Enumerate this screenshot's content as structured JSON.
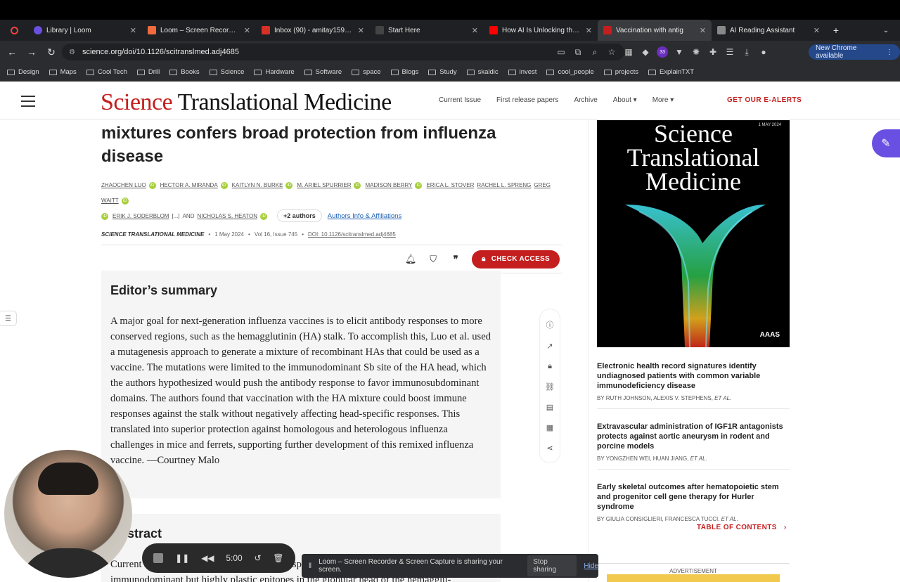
{
  "browser": {
    "tabs": [
      {
        "title": "Library | Loom",
        "color": "#6a4fe3",
        "active": false
      },
      {
        "title": "Loom – Screen Recorder & S",
        "color": "#ef6a3c",
        "active": false
      },
      {
        "title": "Inbox (90) - amitay1599@",
        "color": "#d93025",
        "active": false
      },
      {
        "title": "Start Here",
        "color": "#444444",
        "active": false
      },
      {
        "title": "How AI Is Unlocking the S",
        "color": "#ff0000",
        "active": false
      },
      {
        "title": "Vaccination with antig",
        "color": "#c41e1e",
        "active": true
      },
      {
        "title": "AI Reading Assistant",
        "color": "#888888",
        "active": false
      }
    ],
    "url": "science.org/doi/10.1126/scitranslmed.adj4685",
    "ext_badge": "33",
    "new_chrome": "New Chrome available",
    "bookmarks": [
      "Design",
      "Maps",
      "Cool Tech",
      "Drill",
      "Books",
      "Science",
      "Hardware",
      "Software",
      "space",
      "Blogs",
      "Study",
      "skaldic",
      "invest",
      "cool_people",
      "projects",
      "ExplainTXT"
    ]
  },
  "site": {
    "logo_a": "Science",
    "logo_b": "Translational Medicine",
    "nav": [
      "Current Issue",
      "First release papers",
      "Archive",
      "About ▾",
      "More ▾"
    ],
    "alerts": "GET OUR E-ALERTS"
  },
  "article": {
    "title_line1": "mixtures confers broad protection from influenza",
    "title_line2": "disease",
    "authors_row1": [
      "ZHAOCHEN LUO",
      "HECTOR A. MIRANDA",
      "KAITLYN N. BURKE",
      "M. ARIEL SPURRIER",
      "MADISON BERRY",
      "ERICA L. STOVER",
      "RACHEL L. SPRENG",
      "GREG WAITT"
    ],
    "authors_row2": [
      "ERIK J. SODERBLOM",
      "[...]",
      "AND",
      "NICHOLAS S. HEATON"
    ],
    "more_authors": "+2 authors",
    "affiliations": "Authors Info & Affiliations",
    "journal": "SCIENCE TRANSLATIONAL MEDICINE",
    "date": "1 May 2024",
    "volume": "Vol 16, Issue 745",
    "doi": "DOI: 10.1126/scitranslmed.adj4685",
    "check_access": "CHECK ACCESS",
    "summary_heading": "Editor’s summary",
    "summary_text": "A major goal for next-generation influenza vaccines is to elicit antibody responses to more conserved regions, such as the hemagglutinin (HA) stalk. To accomplish this, Luo et al. used a mutagenesis approach to generate a mixture of recombinant HAs that could be used as a vaccine. The mutations were limited to the immunodominant Sb site of the HA head, which the authors hypothesized would push the antibody response to favor immunosubdominant domains. The authors found that vaccination with the HA mixture could boost immune responses against the stalk without negatively affecting head-specific responses. This translated into superior protection against homologous and heterologous influenza challenges in mice and ferrets, supporting further development of this remixed influenza vaccine. —Courtney Malo",
    "abstract_heading": "Abstract",
    "abstract_text": "Current influenza vaccines elicit antibody responses directed mainly at the immunodominant but highly plastic epitopes in the globular head of the hemagglu-"
  },
  "sidebar": {
    "cover_date": "1 MAY 2024",
    "cover_title": "Science Translational Medicine",
    "cover_publisher": "AAAS",
    "related": [
      {
        "title": "Electronic health record signatures identify undiagnosed patients with common variable immunodeficiency disease",
        "authors": "BY RUTH JOHNSON, ALEXIS V. STEPHENS,",
        "etal": "ET AL."
      },
      {
        "title": "Extravascular administration of IGF1R antagonists protects against aortic aneurysm in rodent and porcine models",
        "authors": "BY YONGZHEN WEI, HUAN JIANG,",
        "etal": "ET AL."
      },
      {
        "title": "Early skeletal outcomes after hematopoietic stem and progenitor cell gene therapy for Hurler syndrome",
        "authors": "BY GIULIA CONSIGLIERI, FRANCESCA TUCCI,",
        "etal": "ET AL."
      }
    ],
    "toc": "TABLE OF CONTENTS",
    "advertisement": "ADVERTISEMENT"
  },
  "loom": {
    "timer": "5:00",
    "share_msg": "Loom – Screen Recorder & Screen Capture is sharing your screen.",
    "stop_sharing": "Stop sharing",
    "hide": "Hide"
  }
}
